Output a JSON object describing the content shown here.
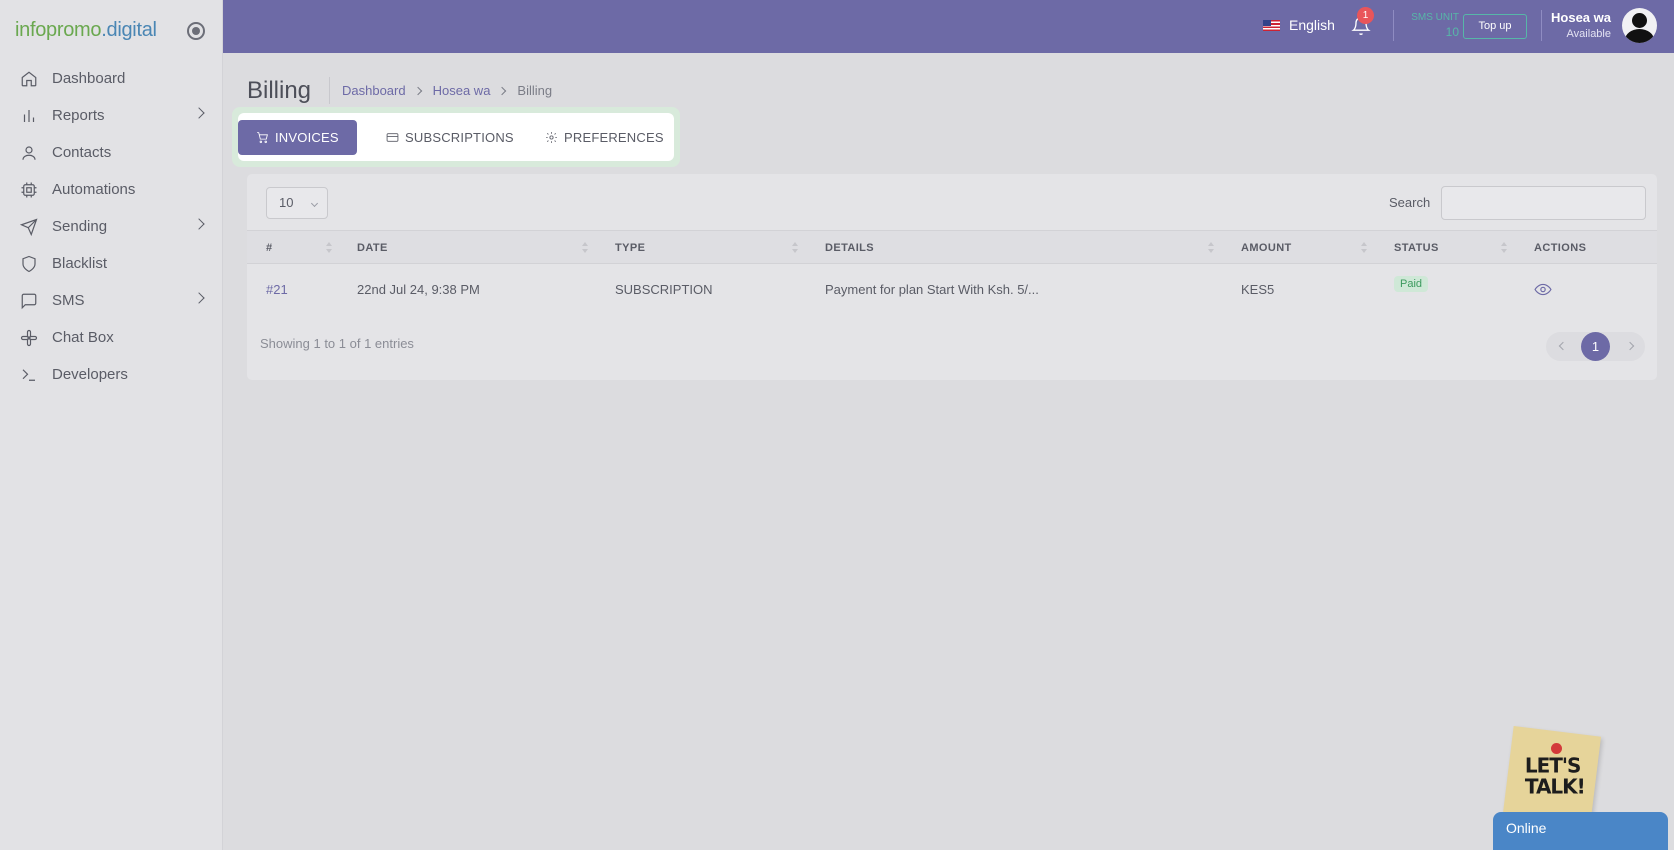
{
  "brand": {
    "part1": "infopromo",
    "part2": ".digital"
  },
  "sidebar": {
    "items": [
      {
        "label": "Dashboard",
        "icon": "home-icon"
      },
      {
        "label": "Reports",
        "icon": "bar-chart-icon"
      },
      {
        "label": "Contacts",
        "icon": "user-icon"
      },
      {
        "label": "Automations",
        "icon": "cpu-icon"
      },
      {
        "label": "Sending",
        "icon": "send-icon"
      },
      {
        "label": "Blacklist",
        "icon": "shield-icon"
      },
      {
        "label": "SMS",
        "icon": "message-icon"
      },
      {
        "label": "Chat Box",
        "icon": "slack-icon"
      },
      {
        "label": "Developers",
        "icon": "terminal-icon"
      }
    ]
  },
  "topbar": {
    "language": "English",
    "notification_count": "1",
    "sms_unit_label": "SMS UNIT",
    "sms_unit_value": "10",
    "topup_label": "Top up",
    "user_name": "Hosea wa",
    "user_status": "Available"
  },
  "header": {
    "title": "Billing",
    "breadcrumb": [
      "Dashboard",
      "Hosea wa",
      "Billing"
    ]
  },
  "tabs": [
    {
      "label": "INVOICES",
      "icon": "cart-icon",
      "active": true
    },
    {
      "label": "SUBSCRIPTIONS",
      "icon": "credit-card-icon",
      "active": false
    },
    {
      "label": "PREFERENCES",
      "icon": "gear-icon",
      "active": false
    }
  ],
  "table": {
    "length_value": "10",
    "search_label": "Search",
    "columns": [
      "#",
      "DATE",
      "TYPE",
      "DETAILS",
      "AMOUNT",
      "STATUS",
      "ACTIONS"
    ],
    "rows": [
      {
        "id": "#21",
        "date": "22nd Jul 24, 9:38 PM",
        "type": "SUBSCRIPTION",
        "details": "Payment for plan Start With Ksh. 5/...",
        "amount": "KES5",
        "status": "Paid"
      }
    ],
    "info": "Showing 1 to 1 of 1 entries",
    "current_page": "1"
  },
  "chat": {
    "sticky_line1": "LET'S",
    "sticky_line2": "TALK!",
    "status": "Online"
  },
  "colors": {
    "primary": "#6d6aa6",
    "accent": "#57b7a8",
    "success": "#3c9a5e",
    "chat": "#4a86c7"
  }
}
